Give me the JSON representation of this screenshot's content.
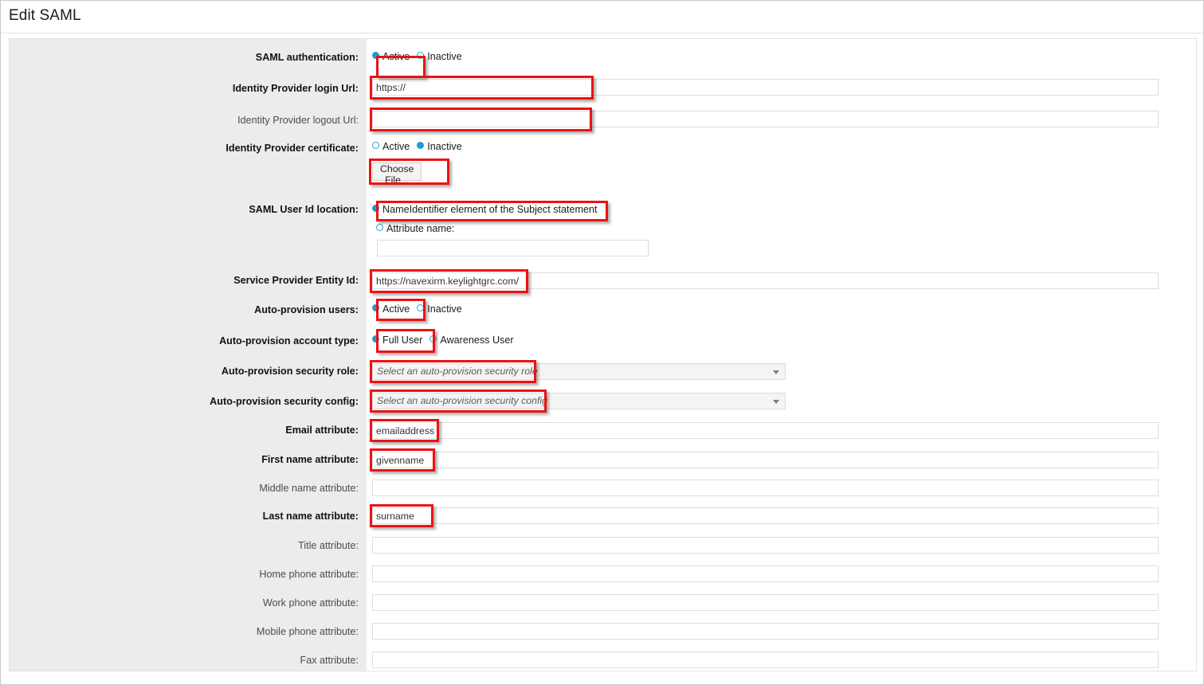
{
  "window": {
    "title": "Edit SAML"
  },
  "form": {
    "rows": [
      {
        "id": "saml-authentication",
        "label": "SAML authentication:",
        "required": true,
        "type": "radio",
        "options": [
          {
            "label": "Active",
            "selected": true
          },
          {
            "label": "Inactive",
            "selected": false
          }
        ],
        "highlight": true
      },
      {
        "id": "identity-provider-login-url",
        "label": "Identity Provider login Url:",
        "required": true,
        "type": "text",
        "value": "https://",
        "highlight": true
      },
      {
        "id": "identity-provider-logout-url",
        "label": "Identity Provider logout Url:",
        "required": false,
        "type": "text",
        "value": "",
        "highlight": true
      },
      {
        "id": "identity-provider-certificate",
        "label": "Identity Provider certificate:",
        "required": true,
        "type": "radio",
        "options": [
          {
            "label": "Active",
            "selected": false
          },
          {
            "label": "Inactive",
            "selected": true
          }
        ],
        "highlight": false
      },
      {
        "id": "choose-file",
        "label": "",
        "required": false,
        "type": "button",
        "value": "Choose File...",
        "highlight": true
      },
      {
        "id": "saml-user-id-location",
        "label": "SAML User Id location:",
        "required": true,
        "type": "radio-stack",
        "options": [
          {
            "label": "NameIdentifier element of the Subject statement",
            "selected": true
          },
          {
            "label": "Attribute name:",
            "selected": false
          }
        ],
        "sub_input_value": "",
        "highlight": true
      },
      {
        "id": "service-provider-entity-id",
        "label": "Service Provider Entity Id:",
        "required": true,
        "type": "text",
        "value": "https://navexirm.keylightgrc.com/",
        "highlight": true
      },
      {
        "id": "auto-provision-users",
        "label": "Auto-provision users:",
        "required": true,
        "type": "radio",
        "options": [
          {
            "label": "Active",
            "selected": true
          },
          {
            "label": "Inactive",
            "selected": false
          }
        ],
        "highlight": true
      },
      {
        "id": "auto-provision-account-type",
        "label": "Auto-provision account type:",
        "required": true,
        "type": "radio",
        "options": [
          {
            "label": "Full User",
            "selected": true
          },
          {
            "label": "Awareness User",
            "selected": false
          }
        ],
        "highlight": true
      },
      {
        "id": "auto-provision-security-role",
        "label": "Auto-provision security role:",
        "required": true,
        "type": "dropdown",
        "value": "Select an auto-provision security role",
        "highlight": true
      },
      {
        "id": "auto-provision-security-config",
        "label": "Auto-provision security config:",
        "required": true,
        "type": "dropdown",
        "value": "Select an auto-provision security config",
        "highlight": true
      },
      {
        "id": "email-attribute",
        "label": "Email attribute:",
        "required": true,
        "type": "text",
        "value": "emailaddress",
        "highlight": true
      },
      {
        "id": "first-name-attribute",
        "label": "First name attribute:",
        "required": true,
        "type": "text",
        "value": "givenname",
        "highlight": true
      },
      {
        "id": "middle-name-attribute",
        "label": "Middle name attribute:",
        "required": false,
        "type": "text",
        "value": "",
        "highlight": false
      },
      {
        "id": "last-name-attribute",
        "label": "Last name attribute:",
        "required": true,
        "type": "text",
        "value": "surname",
        "highlight": true
      },
      {
        "id": "title-attribute",
        "label": "Title attribute:",
        "required": false,
        "type": "text",
        "value": "",
        "highlight": false
      },
      {
        "id": "home-phone-attribute",
        "label": "Home phone attribute:",
        "required": false,
        "type": "text",
        "value": "",
        "highlight": false
      },
      {
        "id": "work-phone-attribute",
        "label": "Work phone attribute:",
        "required": false,
        "type": "text",
        "value": "",
        "highlight": false
      },
      {
        "id": "mobile-phone-attribute",
        "label": "Mobile phone attribute:",
        "required": false,
        "type": "text",
        "value": "",
        "highlight": false
      },
      {
        "id": "fax-attribute",
        "label": "Fax attribute:",
        "required": false,
        "type": "text",
        "value": "",
        "highlight": false
      }
    ]
  },
  "colors": {
    "highlight": "#ee1111",
    "radio_accent": "#1e9ad6",
    "gutter": "#ececec"
  }
}
